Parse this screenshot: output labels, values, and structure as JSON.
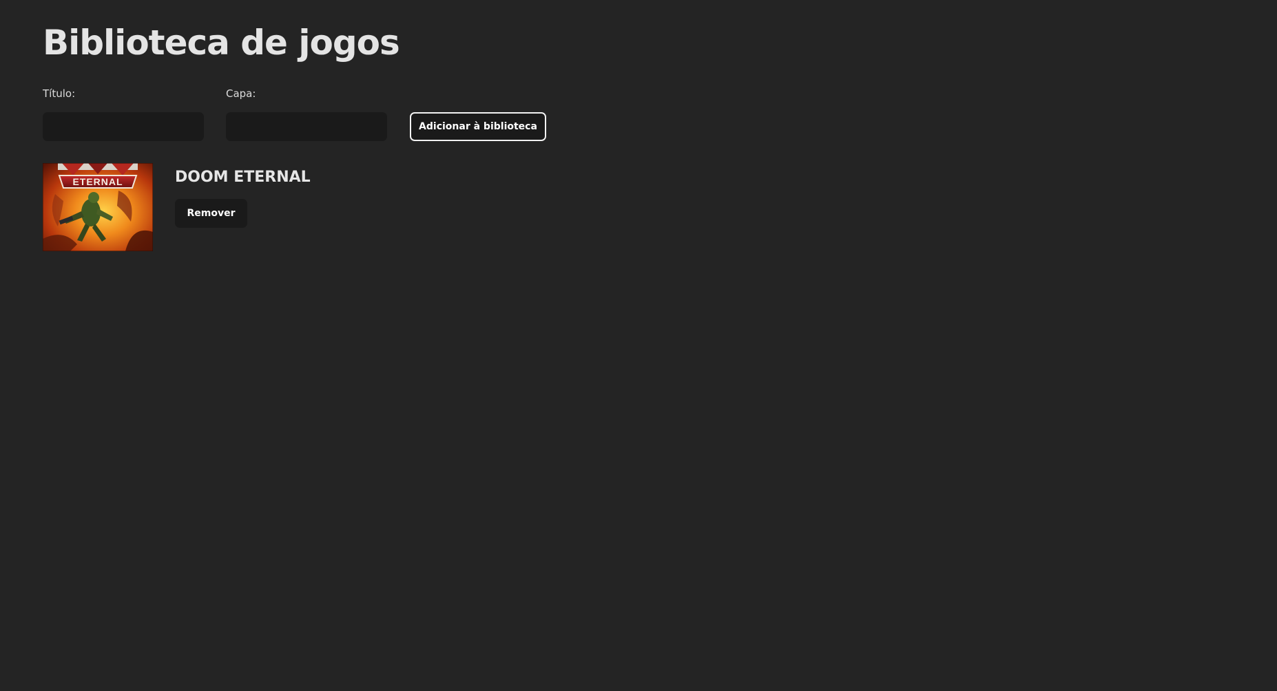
{
  "page": {
    "title": "Biblioteca de jogos"
  },
  "form": {
    "title_label": "Título:",
    "title_value": "",
    "cover_label": "Capa:",
    "cover_value": "",
    "add_button_label": "Adicionar à biblioteca"
  },
  "library": {
    "games": [
      {
        "title": "DOOM ETERNAL",
        "cover_logo": "ETERNAL",
        "remove_label": "Remover"
      }
    ]
  },
  "colors": {
    "background": "#242424",
    "input_background": "#1a1a1a",
    "text": "#e4e4e4",
    "button_border": "#f2f2f2"
  }
}
